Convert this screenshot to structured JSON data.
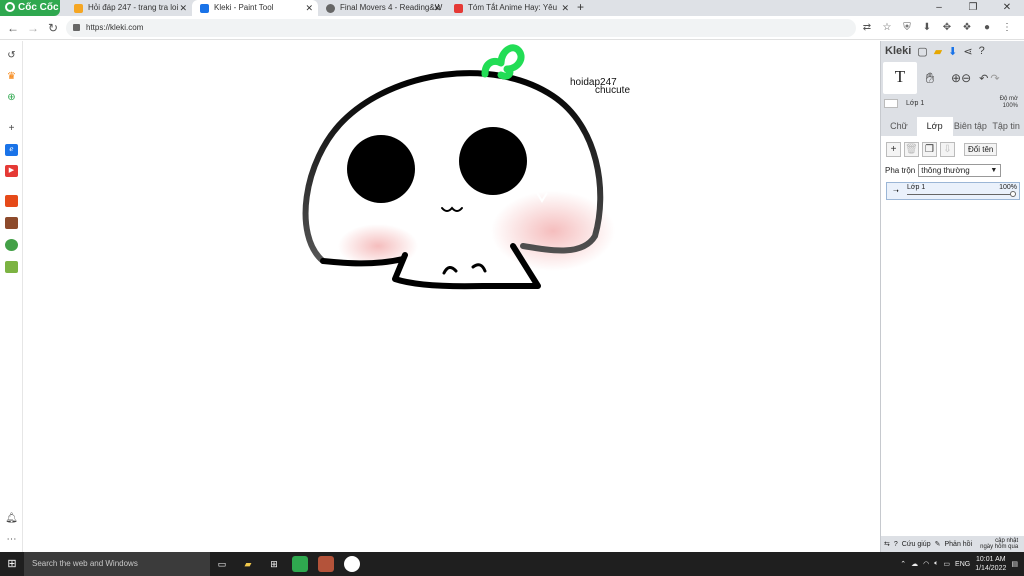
{
  "browser": {
    "brand": "Cốc Cốc",
    "tabs": [
      {
        "title": "Hỏi đáp 247 - trang tra loi",
        "active": false,
        "favicon_color": "#f5a623"
      },
      {
        "title": "Kleki - Paint Tool",
        "active": true,
        "favicon_color": "#1a73e8"
      },
      {
        "title": "Final Movers 4 - Reading&W",
        "active": false,
        "favicon_color": "#666666"
      },
      {
        "title": "Tóm Tắt Anime Hay: Yêu",
        "active": false,
        "favicon_color": "#e53935"
      }
    ],
    "tab_close": "✕",
    "new_tab": "+",
    "window_controls": [
      "–",
      "❐",
      "✕"
    ],
    "nav": {
      "back": "←",
      "forward": "→",
      "reload": "↻"
    },
    "url": "https://kleki.com"
  },
  "canvas": {
    "texts": [
      {
        "text": "hoidap247"
      },
      {
        "text": "chucute"
      }
    ]
  },
  "kleki": {
    "logo": "Kleki",
    "tool_text": "T",
    "layer_name_small": "Lớp 1",
    "opacity_label": "Độ mờ",
    "opacity_value": "100%",
    "tabs": [
      "Chữ",
      "Lớp",
      "Biên tập",
      "Tập tin"
    ],
    "active_tab": "Lớp",
    "rename_button": "Đổi tên",
    "blend_label": "Pha trộn",
    "blend_value": "thông thường",
    "layers": [
      {
        "name": "Lớp 1",
        "opacity": "100%",
        "opacity_fraction": 1.0
      }
    ],
    "footer": {
      "help": "Cứu giúp",
      "feedback": "Phản hồi",
      "updated": "cập nhật",
      "updated_when": "ngày hôm qua"
    }
  },
  "taskbar": {
    "search_placeholder": "Search the web and Windows",
    "language": "ENG",
    "time": "10:01 AM",
    "date": "1/14/2022"
  }
}
